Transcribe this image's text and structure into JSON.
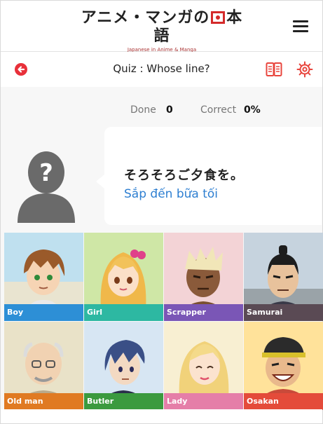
{
  "header": {
    "logo_main_left": "アニメ・マンガの",
    "logo_main_right": "本語",
    "logo_subtitle": "Japanese in Anime & Manga",
    "menu_icon": "hamburger-menu-icon"
  },
  "quiz": {
    "title": "Quiz : Whose line?",
    "back_icon": "back-arrow-icon",
    "book_icon": "book-icon",
    "settings_icon": "gear-icon",
    "accent_color": "#e8303a"
  },
  "score": {
    "done_label": "Done",
    "done_value": "0",
    "correct_label": "Correct",
    "correct_value": "0%"
  },
  "speaker": {
    "unknown_icon": "unknown-person-icon",
    "line_japanese": "そろそろご夕食を。",
    "line_translation": "Sắp đến bữa tối"
  },
  "characters": [
    {
      "label": "Boy",
      "tag_color": "#2d8fd6"
    },
    {
      "label": "Girl",
      "tag_color": "#2db8a2"
    },
    {
      "label": "Scrapper",
      "tag_color": "#7a56b6"
    },
    {
      "label": "Samurai",
      "tag_color": "#5a4a54"
    },
    {
      "label": "Old man",
      "tag_color": "#e07a22"
    },
    {
      "label": "Butler",
      "tag_color": "#3b9a3e"
    },
    {
      "label": "Lady",
      "tag_color": "#e57ea8"
    },
    {
      "label": "Osakan",
      "tag_color": "#e44b3a"
    }
  ]
}
